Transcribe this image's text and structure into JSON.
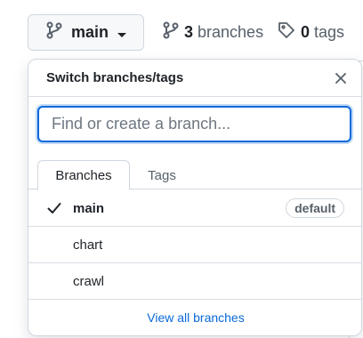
{
  "header": {
    "branch_button_label": "main",
    "branches_count": "3",
    "branches_label": "branches",
    "tags_count": "0",
    "tags_label": "tags"
  },
  "menu": {
    "title": "Switch branches/tags",
    "search_placeholder": "Find or create a branch...",
    "tabs": [
      {
        "label": "Branches",
        "active": true
      },
      {
        "label": "Tags",
        "active": false
      }
    ],
    "branches": [
      {
        "name": "main",
        "selected": true,
        "badge": "default"
      },
      {
        "name": "chart",
        "selected": false
      },
      {
        "name": "crawl",
        "selected": false
      }
    ],
    "footer_link": "View all branches"
  },
  "colors": {
    "accent": "#0969da",
    "text": "#1f2328",
    "muted": "#57606a",
    "border": "#d0d7de"
  }
}
